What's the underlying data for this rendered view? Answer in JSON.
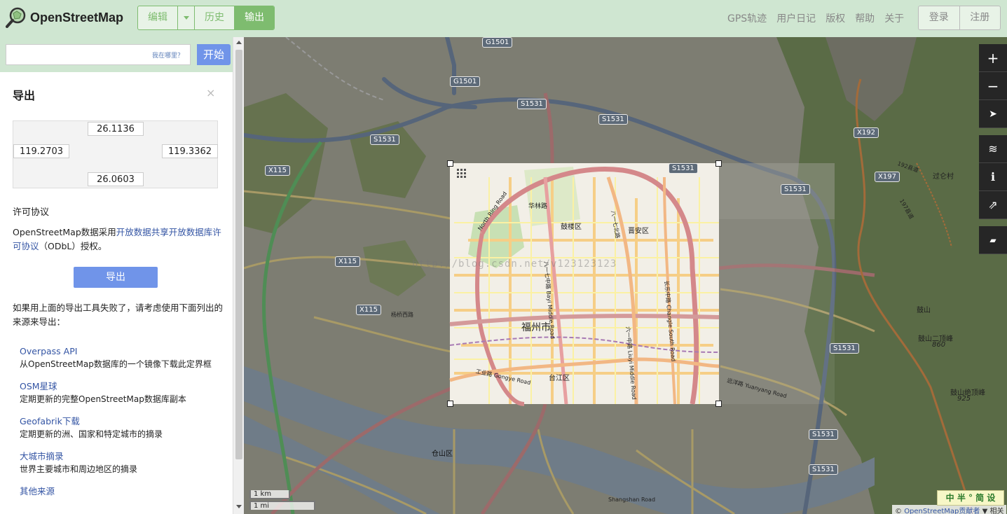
{
  "header": {
    "logo_text": "OpenStreetMap",
    "edit": "编辑",
    "history": "历史",
    "export": "输出",
    "nav": [
      "GPS轨迹",
      "用户日记",
      "版权",
      "帮助",
      "关于"
    ],
    "login": "登录",
    "signup": "注册"
  },
  "search": {
    "value": "",
    "hint": "我在哪里？",
    "go": "开始"
  },
  "panel": {
    "title": "导出",
    "close": "×",
    "bbox": {
      "north": "26.1136",
      "west": "119.2703",
      "east": "119.3362",
      "south": "26.0603"
    },
    "license_heading": "许可协议",
    "license_prefix": "OpenStreetMap数据采用",
    "license_link": "开放数据共享开放数据库许可协议",
    "license_suffix": "（ODbL）授权。",
    "export_button": "导出",
    "fail_note": "如果用上面的导出工具失败了，请考虑使用下面列出的来源来导出：",
    "sources": [
      {
        "name": "Overpass API",
        "desc": "从OpenStreetMap数据库的一个镜像下载此定界框"
      },
      {
        "name": "OSM星球",
        "desc": "定期更新的完整OpenStreetMap数据库副本"
      },
      {
        "name": "Geofabrik下载",
        "desc": "定期更新的洲、国家和特定城市的摘录"
      },
      {
        "name": "大城市摘录",
        "desc": "世界主要城市和周边地区的摘录"
      },
      {
        "name": "其他来源",
        "desc": ""
      }
    ]
  },
  "map": {
    "labels": {
      "city": "福州市",
      "gulou": "鼓楼区",
      "jinan": "晋安区",
      "taijiang": "台江区",
      "cangshan": "仓山区",
      "guoren": "过仑村",
      "gushan": "鼓山",
      "gushan2": "鼓山二顶峰",
      "gushan_peak": "鼓山绝顶峰",
      "elev1": "860",
      "elev2": "925",
      "huali": "华林路",
      "north_ring": "North Ring Road",
      "bayi": "八一七北路",
      "bayi_mid": "八一七中路 Bayi Middle Road",
      "liuyi": "六一中路 Liuyi Middle Road",
      "changle": "长乐中路 Changle South Road",
      "gongye": "工业路 Gongye Road",
      "yangqiao": "杨桥西路",
      "yuanyang": "远洋路 Yuanyang Road",
      "shangshan": "Shangshan Road",
      "road192": "192县道",
      "road197": "197县道"
    },
    "shields": [
      "G1501",
      "G1501",
      "S1531",
      "S1531",
      "S1531",
      "S1531",
      "S1531",
      "S1531",
      "S1531",
      "S1531",
      "X115",
      "X115",
      "X115",
      "X192",
      "X197"
    ],
    "watermark": "http://blog.csdn.net/v123123123",
    "controls": [
      "+",
      "−",
      "➤",
      "≋",
      "ℹ",
      "⇗",
      "▰"
    ],
    "scale_km": "1 km",
    "scale_mi": "1 mi",
    "attribution_prefix": "© ",
    "attribution_link": "OpenStreetMap贡献者",
    "attribution_suffix": " ▼ 相关",
    "ime": "中 半 ° 简 设"
  }
}
